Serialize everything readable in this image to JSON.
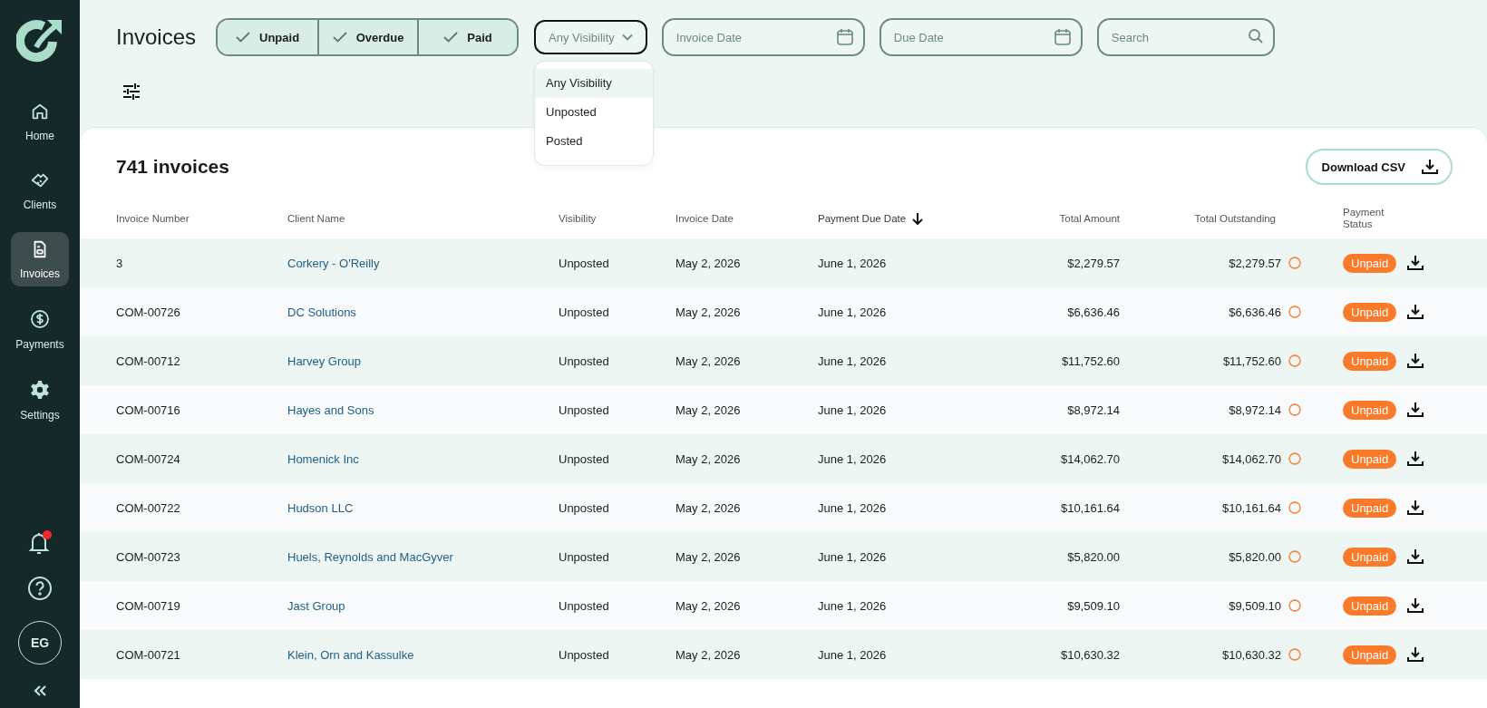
{
  "sidebar": {
    "items": [
      {
        "label": "Home",
        "kind": "home",
        "selected": false
      },
      {
        "label": "Clients",
        "kind": "clients",
        "selected": false
      },
      {
        "label": "Invoices",
        "kind": "invoices",
        "selected": true
      },
      {
        "label": "Payments",
        "kind": "payments",
        "selected": false
      },
      {
        "label": "Settings",
        "kind": "settings",
        "selected": false
      }
    ],
    "notifications": {
      "unread": true
    },
    "avatar": {
      "initials": "EG"
    }
  },
  "toolbar": {
    "title": "Invoices",
    "status_filters": [
      {
        "label": "Unpaid",
        "checked": true
      },
      {
        "label": "Overdue",
        "checked": true
      },
      {
        "label": "Paid",
        "checked": true
      }
    ],
    "visibility_dropdown": {
      "value": "Any Visibility",
      "expanded": true,
      "options": [
        {
          "label": "Any Visibility",
          "selected": true
        },
        {
          "label": "Unposted",
          "selected": false
        },
        {
          "label": "Posted",
          "selected": false
        }
      ]
    },
    "invoice_date": {
      "placeholder": "Invoice Date"
    },
    "due_date": {
      "placeholder": "Due Date"
    },
    "search": {
      "placeholder": "Search"
    }
  },
  "card": {
    "count": "741 invoices",
    "download_button": "Download CSV"
  },
  "table": {
    "columns": [
      {
        "label": "Invoice Number",
        "sorted": false
      },
      {
        "label": "Client Name",
        "sorted": false
      },
      {
        "label": "Visibility",
        "sorted": false
      },
      {
        "label": "Invoice Date",
        "sorted": false
      },
      {
        "label": "Payment Due Date",
        "sorted": true
      },
      {
        "label": "Total Amount",
        "sorted": false
      },
      {
        "label": "Total Outstanding",
        "sorted": false
      },
      {
        "label": "Payment Status",
        "sorted": false
      }
    ],
    "rows": [
      {
        "number": "3",
        "client": "Corkery - O'Reilly",
        "visibility": "Unposted",
        "invoice_date": "May 2, 2026",
        "due_date": "June 1, 2026",
        "total": "$2,279.57",
        "outstanding": "$2,279.57",
        "status": "Unpaid"
      },
      {
        "number": "COM-00726",
        "client": "DC Solutions",
        "visibility": "Unposted",
        "invoice_date": "May 2, 2026",
        "due_date": "June 1, 2026",
        "total": "$6,636.46",
        "outstanding": "$6,636.46",
        "status": "Unpaid"
      },
      {
        "number": "COM-00712",
        "client": "Harvey Group",
        "visibility": "Unposted",
        "invoice_date": "May 2, 2026",
        "due_date": "June 1, 2026",
        "total": "$11,752.60",
        "outstanding": "$11,752.60",
        "status": "Unpaid"
      },
      {
        "number": "COM-00716",
        "client": "Hayes and Sons",
        "visibility": "Unposted",
        "invoice_date": "May 2, 2026",
        "due_date": "June 1, 2026",
        "total": "$8,972.14",
        "outstanding": "$8,972.14",
        "status": "Unpaid"
      },
      {
        "number": "COM-00724",
        "client": "Homenick Inc",
        "visibility": "Unposted",
        "invoice_date": "May 2, 2026",
        "due_date": "June 1, 2026",
        "total": "$14,062.70",
        "outstanding": "$14,062.70",
        "status": "Unpaid"
      },
      {
        "number": "COM-00722",
        "client": "Hudson LLC",
        "visibility": "Unposted",
        "invoice_date": "May 2, 2026",
        "due_date": "June 1, 2026",
        "total": "$10,161.64",
        "outstanding": "$10,161.64",
        "status": "Unpaid"
      },
      {
        "number": "COM-00723",
        "client": "Huels, Reynolds and MacGyver",
        "visibility": "Unposted",
        "invoice_date": "May 2, 2026",
        "due_date": "June 1, 2026",
        "total": "$5,820.00",
        "outstanding": "$5,820.00",
        "status": "Unpaid"
      },
      {
        "number": "COM-00719",
        "client": "Jast Group",
        "visibility": "Unposted",
        "invoice_date": "May 2, 2026",
        "due_date": "June 1, 2026",
        "total": "$9,509.10",
        "outstanding": "$9,509.10",
        "status": "Unpaid"
      },
      {
        "number": "COM-00721",
        "client": "Klein, Orn and Kassulke",
        "visibility": "Unposted",
        "invoice_date": "May 2, 2026",
        "due_date": "June 1, 2026",
        "total": "$10,630.32",
        "outstanding": "$10,630.32",
        "status": "Unpaid"
      }
    ]
  }
}
